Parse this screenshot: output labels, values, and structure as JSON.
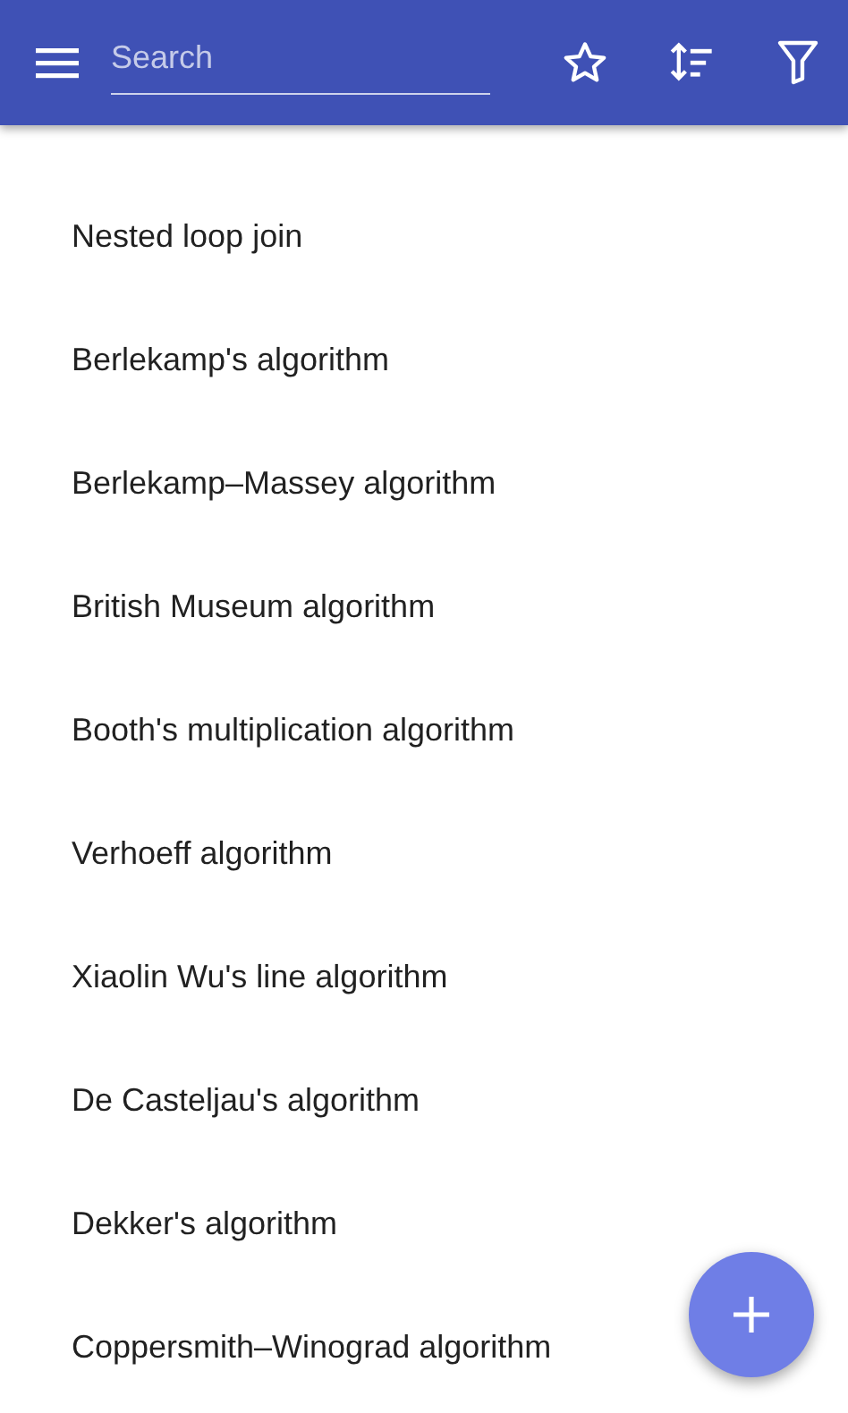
{
  "app_bar": {
    "search": {
      "placeholder": "Search"
    }
  },
  "items": [
    {
      "label": "Nested loop join"
    },
    {
      "label": "Berlekamp's algorithm"
    },
    {
      "label": "Berlekamp–Massey algorithm"
    },
    {
      "label": "British Museum algorithm"
    },
    {
      "label": "Booth's multiplication algorithm"
    },
    {
      "label": "Verhoeff algorithm"
    },
    {
      "label": "Xiaolin Wu's line algorithm"
    },
    {
      "label": "De Casteljau's algorithm"
    },
    {
      "label": "Dekker's algorithm"
    },
    {
      "label": "Coppersmith–Winograd algorithm"
    }
  ]
}
